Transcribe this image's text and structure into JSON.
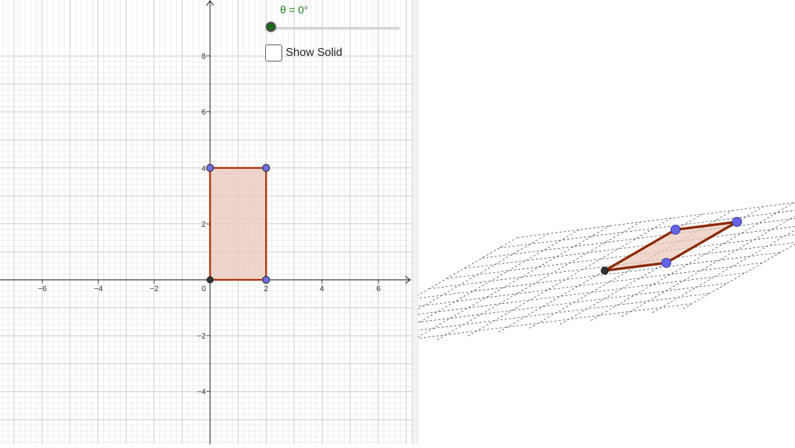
{
  "slider": {
    "label": "θ = 0°",
    "value_degrees": 0,
    "color": "#1a6b1a"
  },
  "checkbox": {
    "label": "Show Solid",
    "checked": false
  },
  "graphics2d": {
    "x_ticks": [
      "−6",
      "−4",
      "−2",
      "0",
      "2",
      "4",
      "6"
    ],
    "y_ticks": [
      "8",
      "6",
      "4",
      "2",
      "−2",
      "−4"
    ],
    "rectangle_vertices": [
      [
        0,
        0
      ],
      [
        2,
        0
      ],
      [
        2,
        4
      ],
      [
        0,
        4
      ]
    ],
    "fill_color": "#e9c7b9",
    "edge_color": "#a8340f",
    "point_color": "#6f6fe0",
    "origin_point_color": "#333333"
  }
}
